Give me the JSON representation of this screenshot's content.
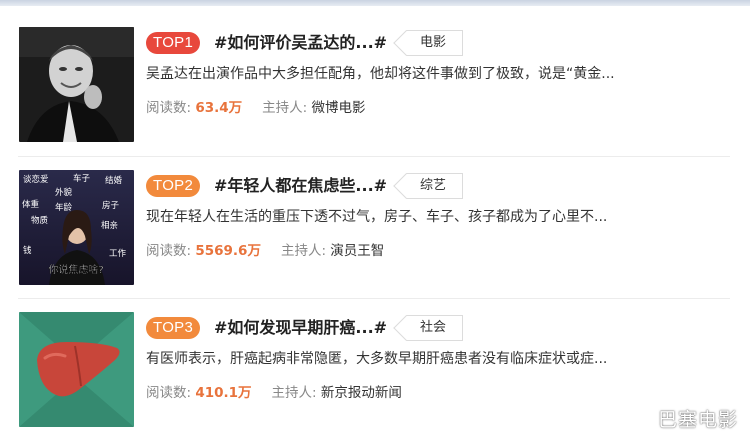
{
  "items": [
    {
      "rank": "TOP1",
      "rank_color": "#e8483c",
      "title": "#如何评价吴孟达的...#",
      "tag": "电影",
      "desc": "吴孟达在出演作品中大多担任配角，他却将这件事做到了极致，说是“黄金...",
      "read_label": "阅读数: ",
      "read_count": "63.4万",
      "host_label": "主持人: ",
      "host": "微博电影",
      "thumb": "portrait-photo"
    },
    {
      "rank": "TOP2",
      "rank_color": "#f28a3c",
      "title": "#年轻人都在焦虑些...#",
      "tag": "综艺",
      "desc": "现在年轻人在生活的重压下透不过气，房子、车子、孩子都成为了心里不...",
      "read_label": "阅读数: ",
      "read_count": "5569.6万",
      "host_label": "主持人: ",
      "host": "演员王智",
      "thumb": "talk-show-photo",
      "thumb_words": [
        "谈恋爱",
        "车子",
        "结婚",
        "外貌",
        "体重",
        "年龄",
        "房子",
        "物质",
        "相亲",
        "钱",
        "工作"
      ],
      "thumb_caption": "你说焦虑啥?"
    },
    {
      "rank": "TOP3",
      "rank_color": "#f28a3c",
      "title": "#如何发现早期肝癌...#",
      "tag": "社会",
      "desc": "有医师表示，肝癌起病非常隐匿，大多数早期肝癌患者没有临床症状或症...",
      "read_label": "阅读数: ",
      "read_count": "410.1万",
      "host_label": "主持人: ",
      "host": "新京报动新闻",
      "thumb": "liver-illustration"
    }
  ],
  "watermark": "巴塞电影"
}
